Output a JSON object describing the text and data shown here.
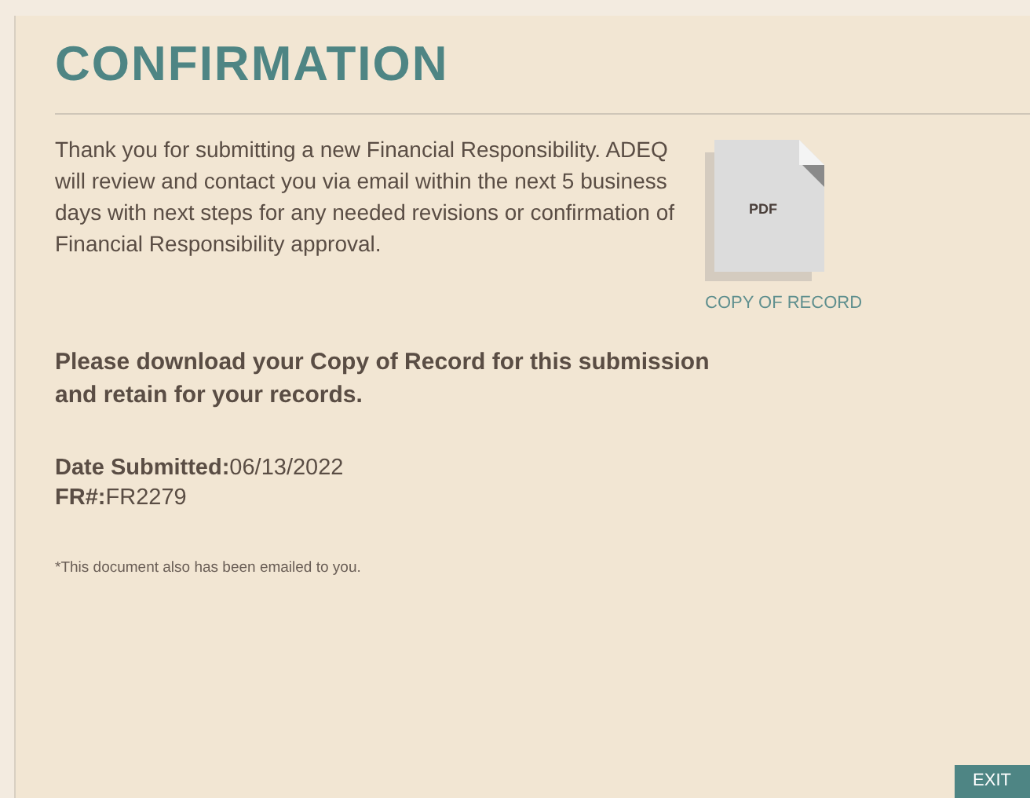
{
  "title": "CONFIRMATION",
  "message": "Thank you for submitting a new Financial Responsibility. ADEQ will review and contact you via email within the next 5 business days with next steps for any needed revisions or confirmation of Financial Responsibility approval.",
  "download_note": "Please download your Copy of Record for this submission and retain for your records.",
  "document": {
    "icon_label": "PDF",
    "link": "COPY OF RECORD"
  },
  "details": [
    {
      "label": "Date Submitted:",
      "value": "06/13/2022"
    },
    {
      "label": "FR#:",
      "value": "FR2279"
    }
  ],
  "footnote": "*This document also has been emailed to you.",
  "exit_button": "EXIT"
}
